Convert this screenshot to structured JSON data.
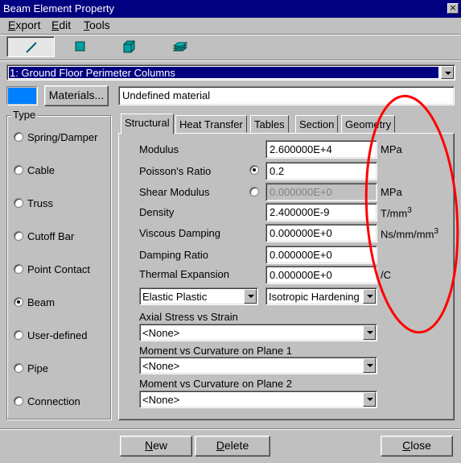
{
  "window": {
    "title": "Beam Element Property",
    "close_glyph": "×"
  },
  "menu": [
    {
      "label": "Export",
      "accel": "E",
      "rest": "xport"
    },
    {
      "label": "Edit",
      "accel": "E",
      "rest": "dit"
    },
    {
      "label": "Tools",
      "accel": "T",
      "rest": "ools"
    }
  ],
  "toolbar": {
    "buttons": [
      "line-element-icon",
      "plate-element-icon",
      "brick-element-icon",
      "layers-icon"
    ],
    "active_index": 0
  },
  "property_select": {
    "value": "1: Ground Floor Perimeter Columns"
  },
  "material": {
    "swatch_color": "#0080ff",
    "button_label": "Materials...",
    "name": "Undefined material"
  },
  "type_group": {
    "legend": "Type",
    "options": [
      "Spring/Damper",
      "Cable",
      "Truss",
      "Cutoff Bar",
      "Point Contact",
      "Beam",
      "User-defined",
      "Pipe",
      "Connection"
    ],
    "selected": "Beam"
  },
  "tabs": [
    "Structural",
    "Heat Transfer",
    "Tables",
    "Section",
    "Geometry"
  ],
  "active_tab": "Structural",
  "structural": {
    "modulus": {
      "label": "Modulus",
      "value": "2.600000E+4",
      "unit": "MPa"
    },
    "poisson": {
      "label": "Poisson's Ratio",
      "value": "0.2",
      "selected": true
    },
    "shear": {
      "label": "Shear Modulus",
      "value": "0.000000E+0",
      "unit": "MPa",
      "selected": false
    },
    "density": {
      "label": "Density",
      "value": "2.400000E-9",
      "unit": "T/mm",
      "unit_sup": "3"
    },
    "viscous": {
      "label": "Viscous Damping",
      "value": "0.000000E+0",
      "unit": "Ns/mm/mm",
      "unit_sup": "3"
    },
    "damping_ratio": {
      "label": "Damping Ratio",
      "value": "0.000000E+0"
    },
    "thermal": {
      "label": "Thermal Expansion",
      "value": "0.000000E+0",
      "unit": "/C"
    },
    "material_model": "Elastic Plastic",
    "hardening": "Isotropic Hardening",
    "axial_label": "Axial Stress vs Strain",
    "axial_value": "<None>",
    "moment1_label": "Moment vs Curvature on Plane 1",
    "moment1_value": "<None>",
    "moment2_label": "Moment vs Curvature on Plane 2",
    "moment2_value": "<None>"
  },
  "buttons": {
    "new": {
      "label": "New",
      "accel": "N",
      "rest": "ew"
    },
    "delete": {
      "label": "Delete",
      "accel": "D",
      "rest": "elete"
    },
    "close": {
      "label": "Close",
      "accel": "C",
      "rest": "lose"
    }
  },
  "annotation_color": "#ff0000"
}
